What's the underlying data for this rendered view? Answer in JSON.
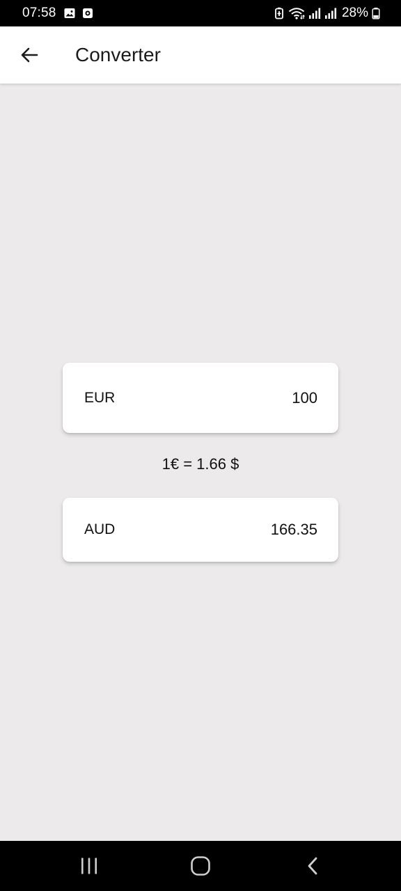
{
  "status_bar": {
    "time": "07:58",
    "left_icons": [
      "gallery-icon",
      "screen-record-icon"
    ],
    "right_icons": [
      "battery-saver-icon",
      "wifi-icon",
      "signal-icon",
      "signal-icon"
    ],
    "battery_percent": "28%"
  },
  "app_bar": {
    "back_icon": "arrow-left-icon",
    "title": "Converter"
  },
  "converter": {
    "from": {
      "currency": "EUR",
      "amount": "100"
    },
    "rate": "1€ = 1.66 $",
    "to": {
      "currency": "AUD",
      "amount": "166.35"
    }
  },
  "nav_bar": {
    "buttons": [
      "recents-icon",
      "home-icon",
      "back-chevron-icon"
    ]
  },
  "colors": {
    "background": "#ECEAEB",
    "surface": "#FFFFFF",
    "text": "#111111",
    "system_bars": "#000000"
  }
}
